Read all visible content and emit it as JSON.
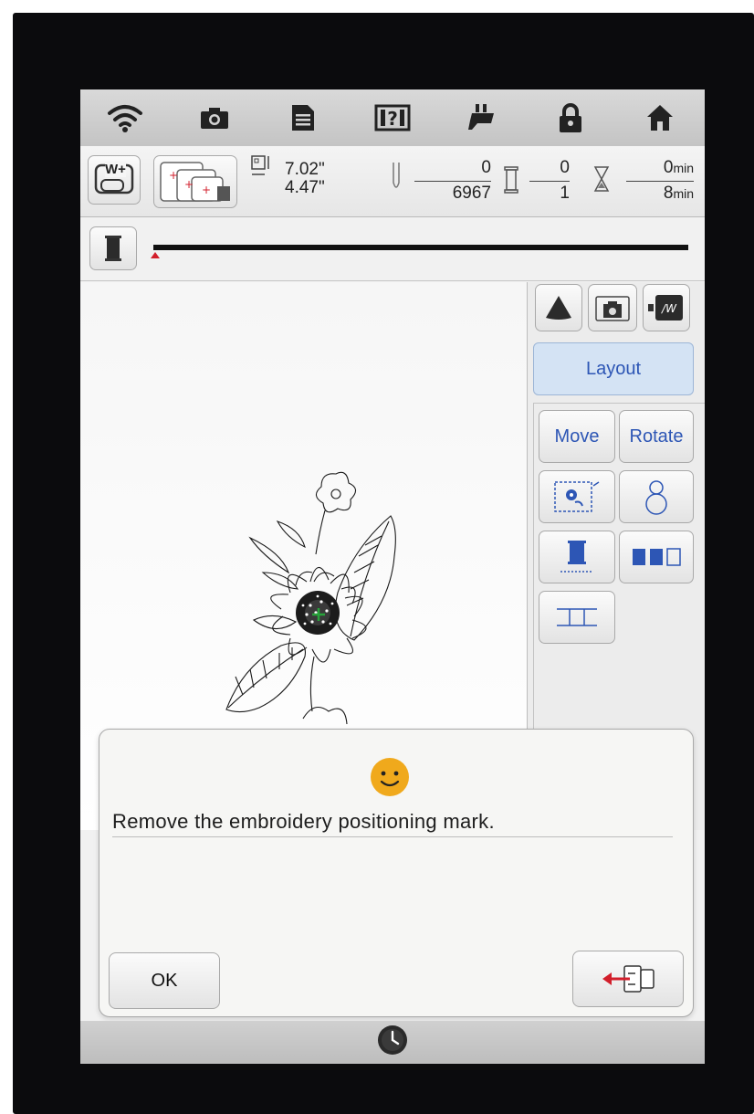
{
  "topbar": {
    "icons": [
      "wifi-icon",
      "camera-icon",
      "document-icon",
      "help-icon",
      "presser-foot-icon",
      "lock-icon",
      "home-icon"
    ]
  },
  "infobar": {
    "frame_button_label": "W+",
    "size_width": "7.02\"",
    "size_height": "4.47\"",
    "stitch_current": "0",
    "stitch_total": "6967",
    "color_current": "0",
    "color_total": "1",
    "time_current": "0",
    "time_total": "8",
    "time_unit": "min"
  },
  "progress": {
    "value": 0
  },
  "panel": {
    "layout_label": "Layout",
    "move_label": "Move",
    "rotate_label": "Rotate"
  },
  "dialog": {
    "message": "Remove the embroidery positioning mark.",
    "ok_label": "OK"
  },
  "colors": {
    "accent": "#2d56b5",
    "layout_bg": "#d4e3f4",
    "smiley": "#f0a91c",
    "progress_marker": "#d21e2b"
  }
}
